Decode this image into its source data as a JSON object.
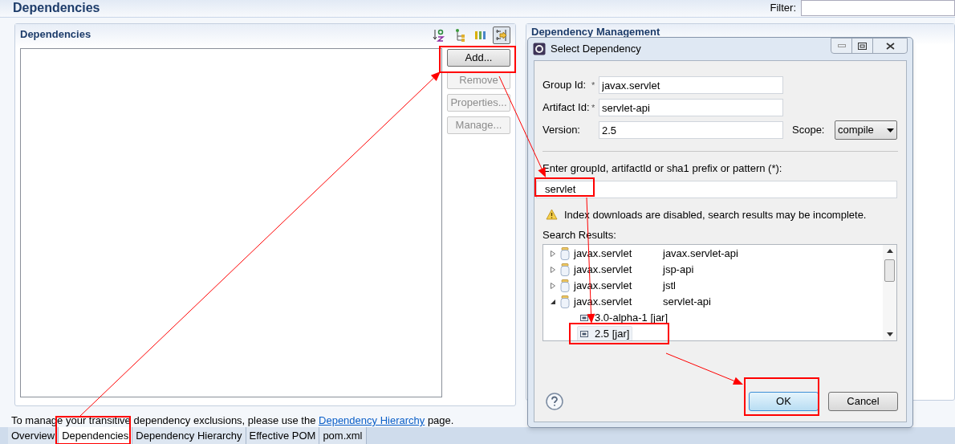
{
  "editor": {
    "title": "Dependencies",
    "filter_label": "Filter:"
  },
  "dependencies_section": {
    "title": "Dependencies",
    "toolbar": [
      {
        "kind": "sort",
        "selected": false
      },
      {
        "kind": "tree",
        "selected": false
      },
      {
        "kind": "columns",
        "selected": false
      },
      {
        "kind": "filter",
        "selected": true
      }
    ],
    "buttons": [
      {
        "label": "Add...",
        "disabled": false
      },
      {
        "label": "Remove",
        "disabled": true
      },
      {
        "label": "Properties...",
        "disabled": true
      },
      {
        "label": "Manage...",
        "disabled": true
      }
    ]
  },
  "note": {
    "before": "To manage your transitive dependency exclusions, please use the",
    "link": "Dependency Hierarchy",
    "after": "page."
  },
  "management_section": {
    "title": "Dependency Management"
  },
  "dialog": {
    "title": "Select Dependency",
    "fields": [
      {
        "label": "Group Id:",
        "required": true,
        "value": "javax.servlet"
      },
      {
        "label": "Artifact Id:",
        "required": true,
        "value": "servlet-api"
      },
      {
        "label": "Version:",
        "required": false,
        "value": "2.5"
      }
    ],
    "required_mark": "*",
    "scope": {
      "label": "Scope:",
      "value": "compile"
    },
    "search_label": "Enter groupId, artifactId or sha1 prefix or pattern (*):",
    "search_value": "servlet",
    "warning": "Index downloads are disabled, search results may be incomplete.",
    "results_label": "Search Results:",
    "results": [
      {
        "group": "javax.servlet",
        "artifact": "javax.servlet-api",
        "expanded": false,
        "selected": false
      },
      {
        "group": "javax.servlet",
        "artifact": "jsp-api",
        "expanded": false,
        "selected": false
      },
      {
        "group": "javax.servlet",
        "artifact": "jstl",
        "expanded": false,
        "selected": false
      },
      {
        "group": "javax.servlet",
        "artifact": "servlet-api",
        "expanded": true,
        "selected": false,
        "children": [
          {
            "label": "3.0-alpha-1 [jar]",
            "selected": false
          },
          {
            "label": "2.5 [jar]",
            "selected": true
          }
        ]
      }
    ],
    "buttons": [
      {
        "label": "OK",
        "default": true
      },
      {
        "label": "Cancel",
        "default": false
      }
    ]
  },
  "tabs": [
    {
      "label": "Overview",
      "selected": false
    },
    {
      "label": "Dependencies",
      "selected": true
    },
    {
      "label": "Dependency Hierarchy",
      "selected": false
    },
    {
      "label": "Effective POM",
      "selected": false
    },
    {
      "label": "pom.xml",
      "selected": false
    }
  ]
}
